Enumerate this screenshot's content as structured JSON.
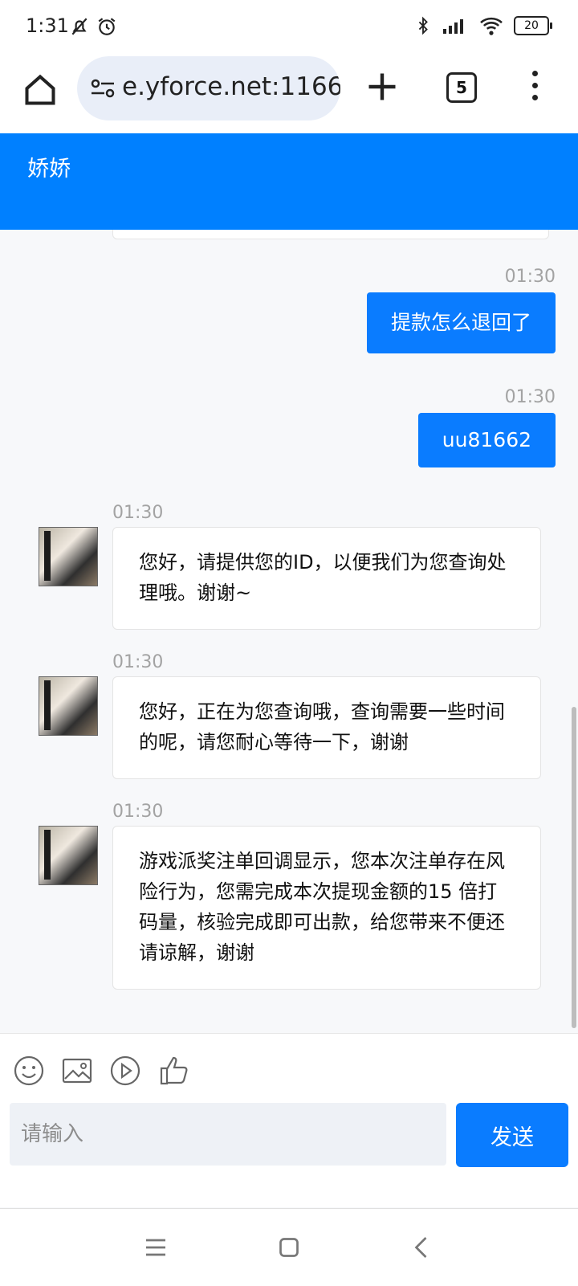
{
  "status_bar": {
    "time": "1:31",
    "battery": "20"
  },
  "browser": {
    "url": "e.yforce.net:1166",
    "tab_count": "5"
  },
  "chat": {
    "title": "娇娇",
    "messages": [
      {
        "side": "out",
        "time": "01:30",
        "text": "提款怎么退回了"
      },
      {
        "side": "out",
        "time": "01:30",
        "text": "uu81662"
      },
      {
        "side": "in",
        "time": "01:30",
        "text": "您好，请提供您的ID，以便我们为您查询处理哦。谢谢~"
      },
      {
        "side": "in",
        "time": "01:30",
        "text": "您好，正在为您查询哦，查询需要一些时间的呢，请您耐心等待一下，谢谢"
      },
      {
        "side": "in",
        "time": "01:30",
        "text": "游戏派奖注单回调显示，您本次注单存在风险行为，您需完成本次提现金额的15 倍打码量，核验完成即可出款，给您带来不便还请谅解，谢谢"
      }
    ]
  },
  "composer": {
    "placeholder": "请输入",
    "send_label": "发送",
    "tools": [
      "emoji-icon",
      "image-icon",
      "video-icon",
      "thumbs-up-icon"
    ]
  },
  "colors": {
    "accent": "#0a7cff",
    "header": "#0080ff"
  }
}
